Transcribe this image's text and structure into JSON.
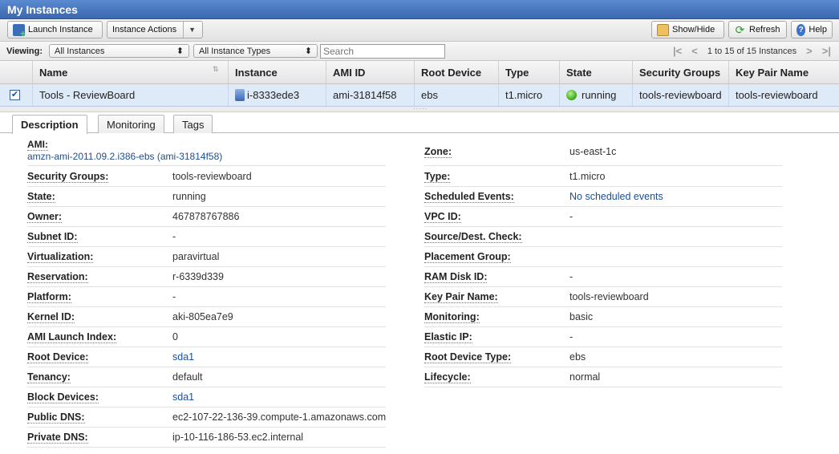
{
  "title": "My Instances",
  "toolbar": {
    "launch": "Launch Instance",
    "actions": "Instance Actions",
    "showhide": "Show/Hide",
    "refresh": "Refresh",
    "help": "Help"
  },
  "viewbar": {
    "viewing_label": "Viewing:",
    "filter1": "All Instances",
    "filter2": "All Instance Types",
    "search_placeholder": "Search",
    "pager_text": "1 to 15 of 15 Instances"
  },
  "grid": {
    "columns": [
      "Name",
      "Instance",
      "AMI ID",
      "Root Device",
      "Type",
      "State",
      "Security Groups",
      "Key Pair Name"
    ],
    "row": {
      "checked": "✔",
      "name": "Tools - ReviewBoard",
      "instance": "i-8333ede3",
      "ami_id": "ami-31814f58",
      "root_device": "ebs",
      "type": "t1.micro",
      "state": "running",
      "security_groups": "tools-reviewboard",
      "key_pair": "tools-reviewboard"
    }
  },
  "tabs": [
    "Description",
    "Monitoring",
    "Tags"
  ],
  "description": {
    "ami_label": "AMI:",
    "ami_value": "amzn-ami-2011.09.2.i386-ebs (ami-31814f58)",
    "zone_label": "Zone:",
    "zone_value": "us-east-1c",
    "left": [
      {
        "label": "Security Groups:",
        "value": "tools-reviewboard",
        "link": false
      },
      {
        "label": "State:",
        "value": "running",
        "link": false
      },
      {
        "label": "Owner:",
        "value": "467878767886",
        "link": false
      },
      {
        "label": "Subnet ID:",
        "value": "-",
        "link": false
      },
      {
        "label": "Virtualization:",
        "value": "paravirtual",
        "link": false
      },
      {
        "label": "Reservation:",
        "value": "r-6339d339",
        "link": false
      },
      {
        "label": "Platform:",
        "value": "-",
        "link": false
      },
      {
        "label": "Kernel ID:",
        "value": "aki-805ea7e9",
        "link": false
      },
      {
        "label": "AMI Launch Index:",
        "value": "0",
        "link": false
      },
      {
        "label": "Root Device:",
        "value": "sda1",
        "link": true
      },
      {
        "label": "Tenancy:",
        "value": "default",
        "link": false
      },
      {
        "label": "Block Devices:",
        "value": "sda1",
        "link": true
      },
      {
        "label": "Public DNS:",
        "value": "ec2-107-22-136-39.compute-1.amazonaws.com",
        "link": false
      },
      {
        "label": "Private DNS:",
        "value": "ip-10-116-186-53.ec2.internal",
        "link": false
      }
    ],
    "right": [
      {
        "label": "Type:",
        "value": "t1.micro",
        "link": false
      },
      {
        "label": "Scheduled Events:",
        "value": "No scheduled events",
        "link": true
      },
      {
        "label": "VPC ID:",
        "value": "-",
        "link": false
      },
      {
        "label": "Source/Dest. Check:",
        "value": "",
        "link": false
      },
      {
        "label": "Placement Group:",
        "value": "",
        "link": false
      },
      {
        "label": "RAM Disk ID:",
        "value": "-",
        "link": false
      },
      {
        "label": "Key Pair Name:",
        "value": "tools-reviewboard",
        "link": false
      },
      {
        "label": "Monitoring:",
        "value": "basic",
        "link": false
      },
      {
        "label": "Elastic IP:",
        "value": "-",
        "link": false
      },
      {
        "label": "Root Device Type:",
        "value": "ebs",
        "link": false
      },
      {
        "label": "Lifecycle:",
        "value": "normal",
        "link": false
      }
    ]
  },
  "colors": {
    "titlebar": "#3b68b0",
    "selected_row": "#dfeaf9",
    "link": "#1a4f93",
    "running": "#3aa617"
  }
}
